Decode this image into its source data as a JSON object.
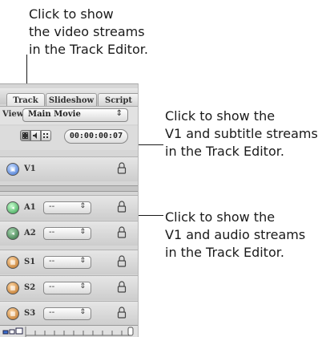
{
  "callouts": {
    "video": "Click to show\nthe video streams\nin the Track Editor.",
    "subtitle": "Click to show the\nV1 and subtitle streams\nin the Track Editor.",
    "audio": "Click to show the\nV1 and audio streams\nin the Track Editor."
  },
  "tabs": [
    {
      "label": "Track"
    },
    {
      "label": "Slideshow"
    },
    {
      "label": "Script"
    }
  ],
  "view": {
    "label": "View:",
    "selected": "Main Movie"
  },
  "toolbar": {
    "timecode": "00:00:00:07"
  },
  "tracks": [
    {
      "name": "V1",
      "kind": "video",
      "select": ""
    },
    {
      "name": "A1",
      "kind": "audio",
      "select": "--"
    },
    {
      "name": "A2",
      "kind": "audio",
      "select": "--"
    },
    {
      "name": "S1",
      "kind": "subtitle",
      "select": "--"
    },
    {
      "name": "S2",
      "kind": "subtitle",
      "select": "--"
    },
    {
      "name": "S3",
      "kind": "subtitle",
      "select": "--"
    }
  ],
  "icons": {
    "video_stream_button": "video-stream-icon",
    "audio_stream_button": "audio-stream-icon",
    "subtitle_stream_button": "subtitle-stream-icon",
    "lock": "lock-icon"
  }
}
